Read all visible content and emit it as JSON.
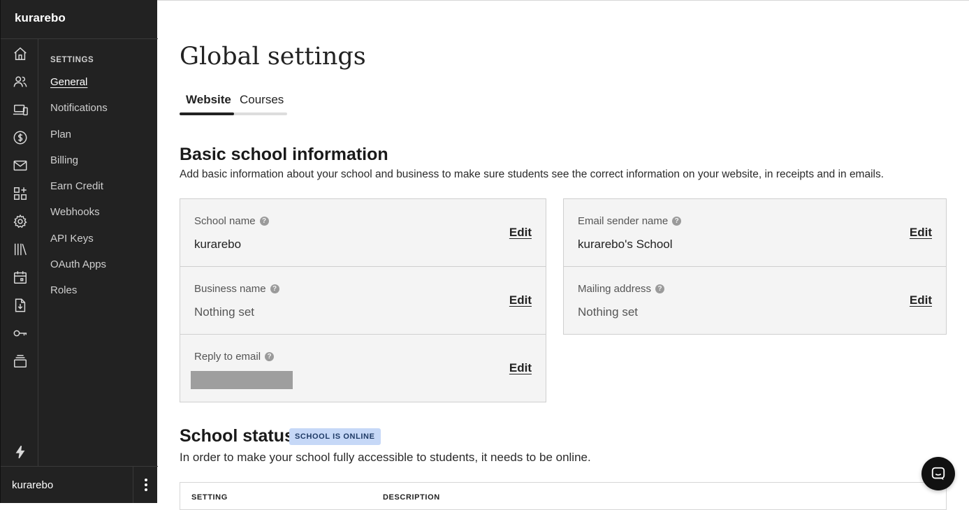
{
  "app": {
    "brand": "kurarebo"
  },
  "sidebar": {
    "heading": "SETTINGS",
    "items": [
      {
        "label": "General",
        "active": true
      },
      {
        "label": "Notifications"
      },
      {
        "label": "Plan"
      },
      {
        "label": "Billing"
      },
      {
        "label": "Earn Credit"
      },
      {
        "label": "Webhooks"
      },
      {
        "label": "API Keys"
      },
      {
        "label": "OAuth Apps"
      },
      {
        "label": "Roles"
      }
    ],
    "rail_icons": [
      "home-icon",
      "users-icon",
      "devices-icon",
      "dollar-icon",
      "mail-icon",
      "apps-icon",
      "gear-icon",
      "library-icon",
      "calendar-icon",
      "download-icon",
      "key-icon",
      "stack-icon",
      "lightning-icon"
    ],
    "user": {
      "name": "kurarebo"
    }
  },
  "page": {
    "title": "Global settings",
    "tabs": [
      {
        "label": "Website",
        "active": true
      },
      {
        "label": "Courses"
      }
    ]
  },
  "basic_info": {
    "title": "Basic school information",
    "description": "Add basic information about your school and business to make sure students see the correct information on your website, in receipts and in emails.",
    "edit_label": "Edit",
    "left_fields": [
      {
        "label": "School name",
        "value": "kurarebo"
      },
      {
        "label": "Business name",
        "value": "Nothing set"
      },
      {
        "label": "Reply to email",
        "value": ""
      }
    ],
    "right_fields": [
      {
        "label": "Email sender name",
        "value": "kurarebo's School"
      },
      {
        "label": "Mailing address",
        "value": "Nothing set"
      }
    ]
  },
  "school_status": {
    "title": "School status",
    "badge": "SCHOOL IS ONLINE",
    "description": "In order to make your school fully accessible to students, it needs to be online.",
    "table_headers": [
      "SETTING",
      "DESCRIPTION"
    ]
  },
  "colors": {
    "sidebar_bg": "#222222",
    "badge_bg": "#c6d8f7",
    "card_bg": "#f4f4f4"
  }
}
